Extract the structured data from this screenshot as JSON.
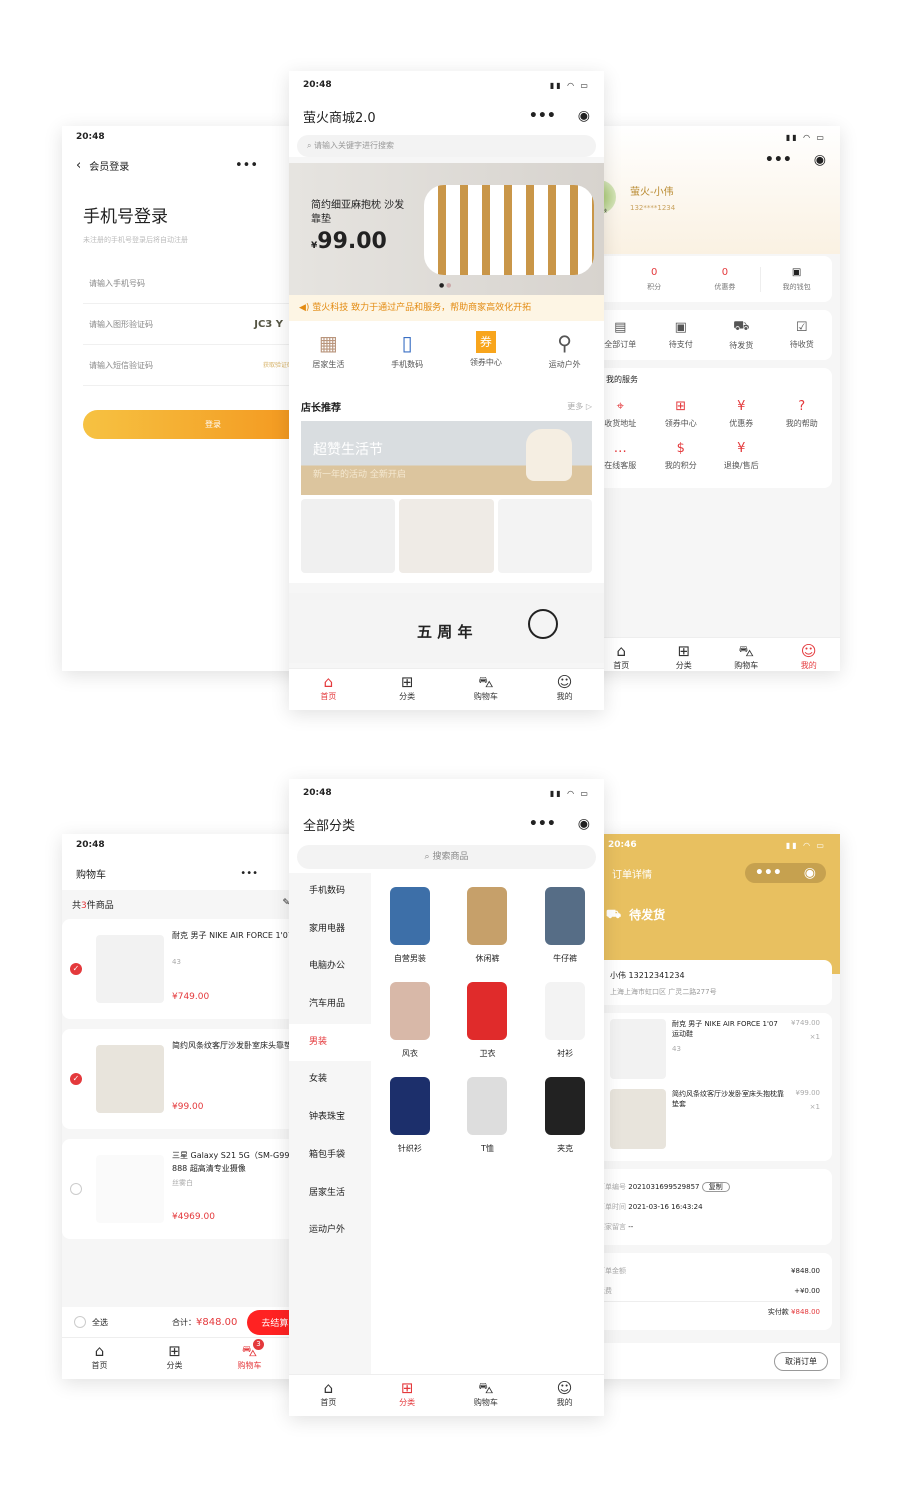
{
  "status": {
    "time": "20:48",
    "time_order": "20:46",
    "battery": "100"
  },
  "login": {
    "nav_title": "会员登录",
    "title": "手机号登录",
    "subtitle": "未注册的手机号登录后将自动注册",
    "phone_placeholder": "请输入手机号码",
    "captcha_placeholder": "请输入图形验证码",
    "captcha_text": "JC3 Y",
    "sms_placeholder": "请输入短信验证码",
    "sms_button": "获取验证码",
    "login_button": "登录"
  },
  "home": {
    "title": "萤火商城2.0",
    "search_placeholder": "请输入关键字进行搜索",
    "banner": {
      "title": "简约细亚麻抱枕 沙发靠垫",
      "currency": "¥",
      "price": "99.00"
    },
    "notice": "萤火科技 致力于通过产品和服务，帮助商家高效化开拓",
    "categories": [
      {
        "label": "居家生活"
      },
      {
        "label": "手机数码"
      },
      {
        "label": "领券中心",
        "badge": "券"
      },
      {
        "label": "运动户外"
      }
    ],
    "section_title": "店长推荐",
    "more": "更多",
    "promo": {
      "title": "超赞生活节",
      "subtitle": "新一年的活动 全新开启"
    },
    "anniv": "五 周 年"
  },
  "tabs": {
    "home": "首页",
    "category": "分类",
    "cart": "购物车",
    "mine": "我的"
  },
  "profile": {
    "name": "萤火-小伟",
    "phone": "132****1234",
    "avatar_text": "萤火科技",
    "stats": [
      {
        "value": "0.00",
        "label": "账户余额"
      },
      {
        "value": "0",
        "label": "积分"
      },
      {
        "value": "0",
        "label": "优惠券"
      }
    ],
    "wallet": "我的钱包",
    "orders": [
      "全部订单",
      "待支付",
      "待发货",
      "待收货"
    ],
    "services_title": "我的服务",
    "services": [
      "收货地址",
      "领券中心",
      "优惠券",
      "我的帮助",
      "在线客服",
      "我的积分",
      "退换/售后"
    ]
  },
  "cart": {
    "title": "购物车",
    "count_prefix": "共",
    "count": "3",
    "count_suffix": "件商品",
    "items": [
      {
        "name": "耐克 男子 NIKE AIR FORCE 1'07 运动鞋",
        "spec": "43",
        "price": "¥749.00",
        "qty": "1",
        "checked": true
      },
      {
        "name": "简约风条纹客厅沙发卧室床头靠垫套",
        "spec": "",
        "price": "¥99.00",
        "qty": "1",
        "checked": true
      },
      {
        "name": "三星 Galaxy S21 5G（SM-G9910）双模5G 骁龙888 超高清专业摄像",
        "spec": "丝雾白",
        "price": "¥4969.00",
        "qty": "1",
        "checked": false
      }
    ],
    "select_all": "全选",
    "total_label": "合计：",
    "total": "¥848.00",
    "checkout": "去结算 (2)",
    "badge": "3"
  },
  "category": {
    "title": "全部分类",
    "search_placeholder": "搜索商品",
    "sidebar": [
      "手机数码",
      "家用电器",
      "电脑办公",
      "汽车用品",
      "男装",
      "女装",
      "钟表珠宝",
      "箱包手袋",
      "居家生活",
      "运动户外"
    ],
    "active": "男装",
    "products": [
      "自营男装",
      "休闲裤",
      "牛仔裤",
      "风衣",
      "卫衣",
      "衬衫",
      "针织衫",
      "T恤",
      "夹克"
    ]
  },
  "order": {
    "title": "订单详情",
    "status": "待发货",
    "receiver": "小伟 13212341234",
    "address": "上海上海市虹口区 广灵二路277号",
    "items": [
      {
        "name": "耐克 男子 NIKE AIR FORCE 1'07 运动鞋",
        "spec": "43",
        "price": "¥749.00",
        "qty": "×1"
      },
      {
        "name": "简约风条纹客厅沙发卧室床头抱枕靠垫套",
        "price": "¥99.00",
        "qty": "×1"
      }
    ],
    "order_no_label": "订单编号",
    "order_no": "2021031699529857",
    "copy": "复制",
    "time_label": "下单时间",
    "time": "2021-03-16 16:43:24",
    "remark_label": "买家留言",
    "remark": "--",
    "amount_label": "订单金额",
    "amount": "¥848.00",
    "freight_label": "运费",
    "freight": "+¥0.00",
    "paid_label": "实付款",
    "paid": "¥848.00",
    "cancel": "取消订单"
  },
  "colors": {
    "accent": "#e4393c",
    "login_gradient_start": "#f6c242",
    "login_gradient_end": "#f39019",
    "order_header": "#e8c060",
    "notice_text": "#e38b12"
  }
}
